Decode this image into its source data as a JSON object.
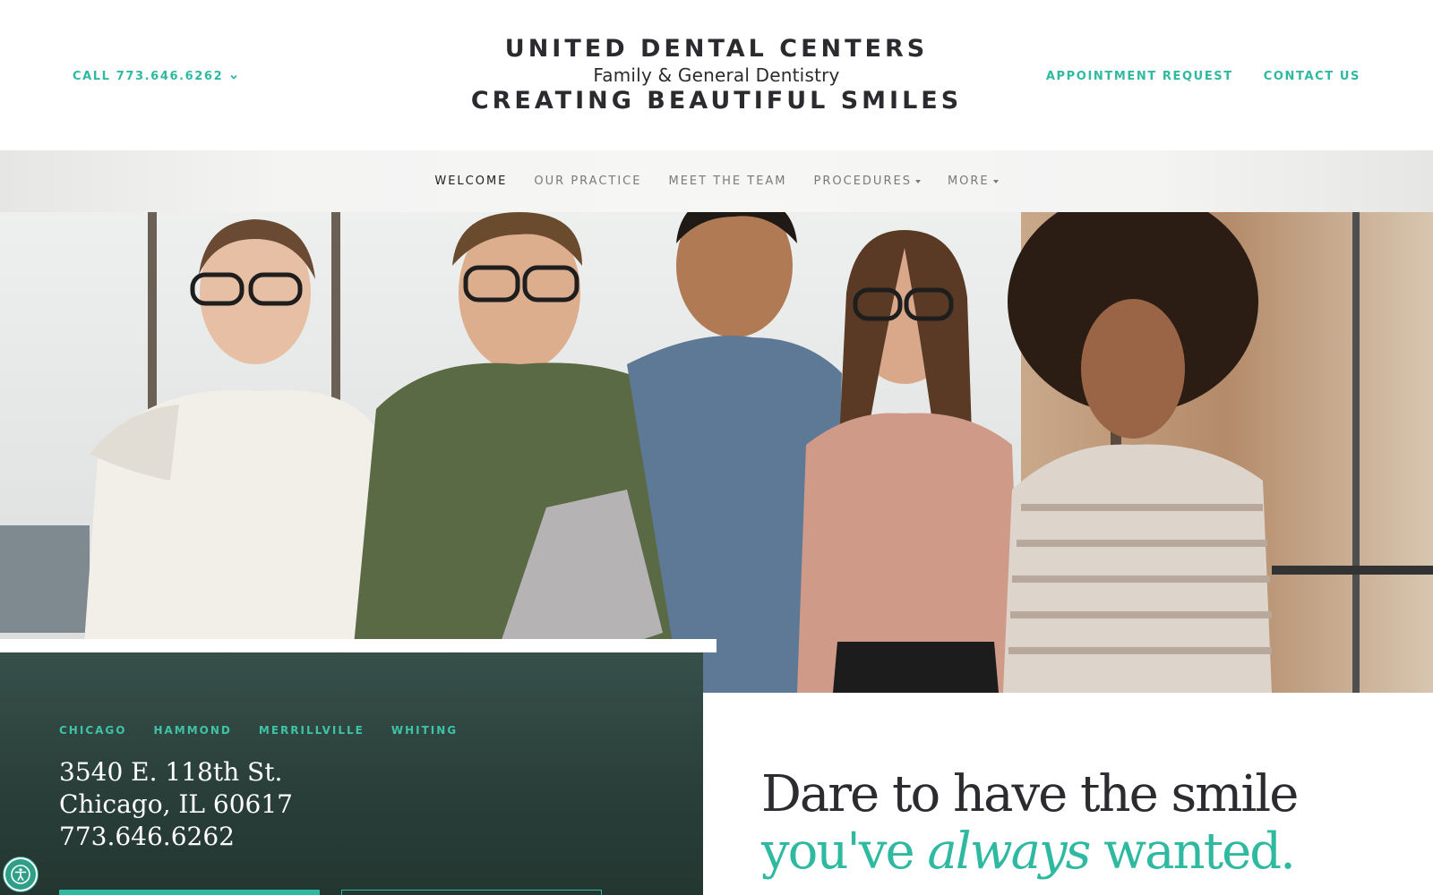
{
  "header": {
    "call_label": "CALL 773.646.6262",
    "brand_line1": "UNITED DENTAL CENTERS",
    "brand_line2": "Family & General Dentistry",
    "brand_line3": "CREATING BEAUTIFUL SMILES",
    "appointment_label": "APPOINTMENT REQUEST",
    "contact_label": "CONTACT US"
  },
  "nav": {
    "items": [
      {
        "label": "WELCOME",
        "active": true
      },
      {
        "label": "OUR PRACTICE"
      },
      {
        "label": "MEET THE TEAM"
      },
      {
        "label": "PROCEDURES",
        "dropdown": true
      },
      {
        "label": "MORE",
        "dropdown": true
      }
    ]
  },
  "locations": {
    "tabs": [
      "CHICAGO",
      "HAMMOND",
      "MERRILLVILLE",
      "WHITING"
    ],
    "address_line1": "3540 E. 118th St.",
    "address_line2": "Chicago, IL 60617",
    "phone": "773.646.6262"
  },
  "tagline": {
    "line1": "Dare to have the smile",
    "line2_a": "you've ",
    "line2_b": "always",
    "line2_c": " wanted."
  },
  "icons": {
    "chevron": "chevron-down-icon",
    "accessibility": "accessibility-icon"
  },
  "colors": {
    "accent": "#2fb9a0",
    "card": "#2f4540",
    "text_dark": "#2b2b30"
  }
}
